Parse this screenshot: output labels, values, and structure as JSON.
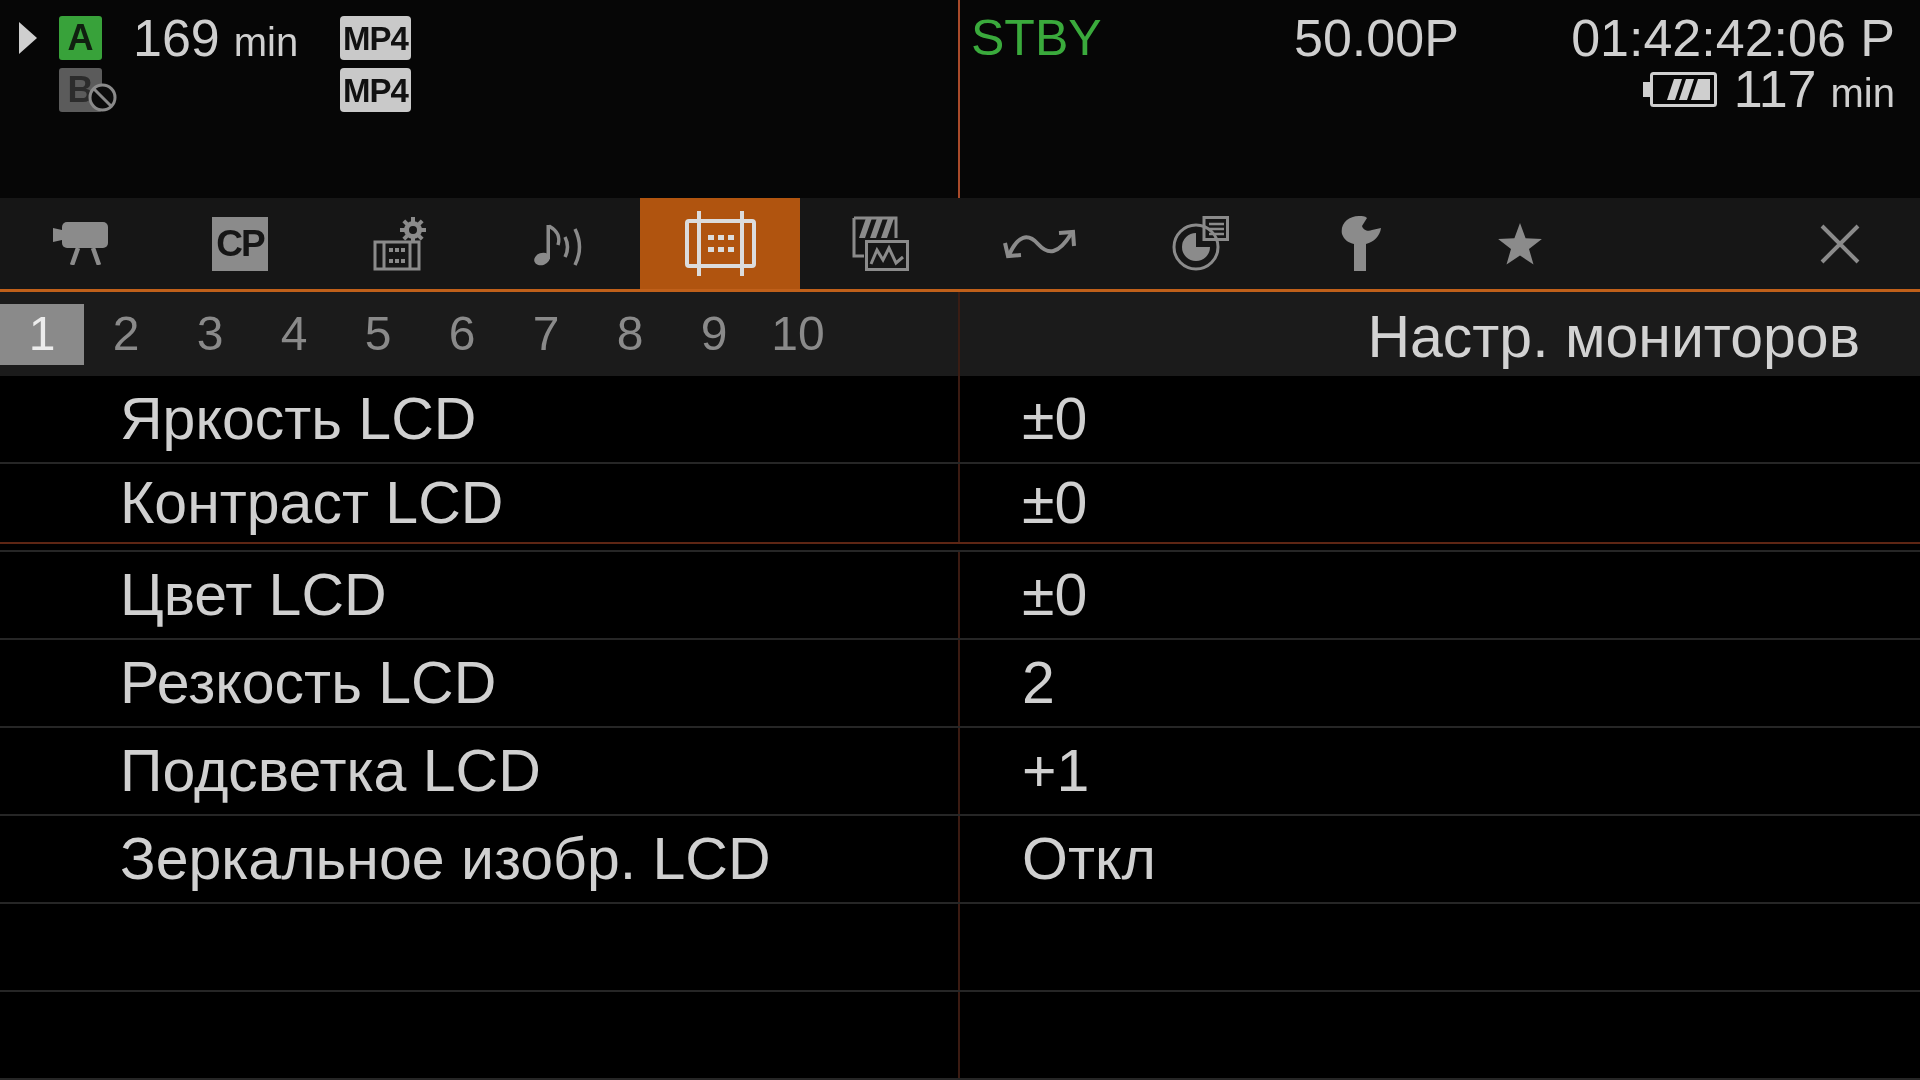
{
  "status": {
    "media": [
      {
        "slot": "A",
        "selected": true,
        "available": true,
        "remaining": "169",
        "unit": "min",
        "format": "MP4"
      },
      {
        "slot": "B",
        "selected": false,
        "available": false,
        "format": "MP4"
      }
    ],
    "mode": "STBY",
    "frame_rate": "50.00P",
    "timecode": "01:42:42:06 P",
    "battery": {
      "remaining": "117",
      "unit": "min"
    }
  },
  "tabs": [
    {
      "kind": "icon",
      "selected": false
    },
    {
      "kind": "text",
      "label": "CP",
      "selected": false
    },
    {
      "kind": "icon",
      "selected": false
    },
    {
      "kind": "icon",
      "selected": false
    },
    {
      "kind": "icon",
      "selected": true
    },
    {
      "kind": "icon",
      "selected": false
    },
    {
      "kind": "icon",
      "selected": false
    },
    {
      "kind": "icon",
      "selected": false
    },
    {
      "kind": "icon",
      "selected": false
    },
    {
      "kind": "icon",
      "selected": false
    }
  ],
  "pages": [
    {
      "label": "1",
      "selected": true
    },
    {
      "label": "2",
      "selected": false
    },
    {
      "label": "3",
      "selected": false
    },
    {
      "label": "4",
      "selected": false
    },
    {
      "label": "5",
      "selected": false
    },
    {
      "label": "6",
      "selected": false
    },
    {
      "label": "7",
      "selected": false
    },
    {
      "label": "8",
      "selected": false
    },
    {
      "label": "9",
      "selected": false
    },
    {
      "label": "10",
      "selected": false
    }
  ],
  "menu_title": "Настр. мониторов",
  "rows": [
    {
      "label": "Яркость LCD",
      "value": "±0",
      "group_end": false
    },
    {
      "label": "Контраст LCD",
      "value": "±0",
      "group_end": true
    },
    {
      "label": "Цвет LCD",
      "value": "±0",
      "group_end": false
    },
    {
      "label": "Резкость LCD",
      "value": "2",
      "group_end": false
    },
    {
      "label": "Подсветка LCD",
      "value": "+1",
      "group_end": false
    },
    {
      "label": "Зеркальное изобр. LCD",
      "value": "Откл",
      "group_end": false
    }
  ]
}
